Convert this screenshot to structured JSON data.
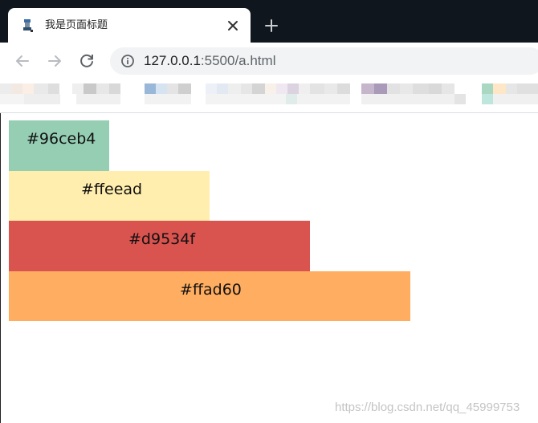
{
  "browser": {
    "tab": {
      "title": "我是页面标题"
    },
    "address": {
      "host": "127.0.0.1",
      "rest": ":5500/a.html"
    }
  },
  "colors": {
    "tab_strip": "#0f161d",
    "omnibox": "#f1f3f4",
    "bar_1": "#96ceb4",
    "bar_2": "#ffeead",
    "bar_3": "#d9534f",
    "bar_4": "#ffad60"
  },
  "boxes": [
    {
      "label": "#96ceb4",
      "color": "#96ceb4"
    },
    {
      "label": "#ffeead",
      "color": "#ffeead"
    },
    {
      "label": "#d9534f",
      "color": "#d9534f"
    },
    {
      "label": "#ffad60",
      "color": "#ffad60"
    }
  ],
  "watermark": "https://blog.csdn.net/qq_45999753",
  "icons": [
    "favicon-icon",
    "close-icon",
    "plus-icon",
    "back-arrow-icon",
    "forward-arrow-icon",
    "reload-icon",
    "info-icon"
  ]
}
